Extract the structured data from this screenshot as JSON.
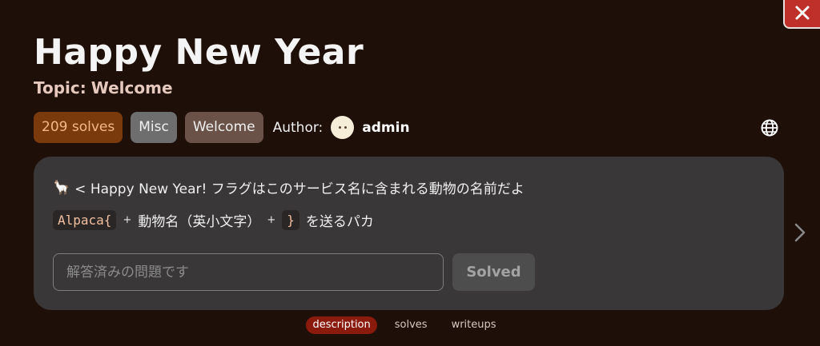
{
  "window": {
    "close_icon": "close-icon"
  },
  "challenge": {
    "title": "Happy New Year",
    "topic_label": "Topic:",
    "topic_value": "Welcome"
  },
  "tags": {
    "solves": "209 solves",
    "category": "Misc",
    "topic": "Welcome"
  },
  "author": {
    "label": "Author:",
    "name": "admin"
  },
  "description": {
    "line1_icon": "🦙",
    "line1_text": "< Happy New Year! フラグはこのサービス名に含まれる動物の名前だよ",
    "code_prefix": "Alpaca{",
    "plus1": "+",
    "middle_text": "動物名（英小文字）",
    "plus2": "+",
    "code_suffix": "}",
    "tail_text": "を送るパカ"
  },
  "flag_form": {
    "placeholder": "解答済みの問題です",
    "value": "",
    "submit_label": "Solved"
  },
  "bottom_tabs": [
    {
      "label": "description",
      "active": true
    },
    {
      "label": "solves",
      "active": false
    },
    {
      "label": "writeups",
      "active": false
    }
  ],
  "colors": {
    "background": "#1e0f08",
    "card": "#393737",
    "accent_red": "#c0302a",
    "solves_badge": "#7a3a0c",
    "active_tab": "#8a1a0c"
  },
  "icons": {
    "globe": "globe-icon",
    "next": "chevron-right-icon"
  }
}
